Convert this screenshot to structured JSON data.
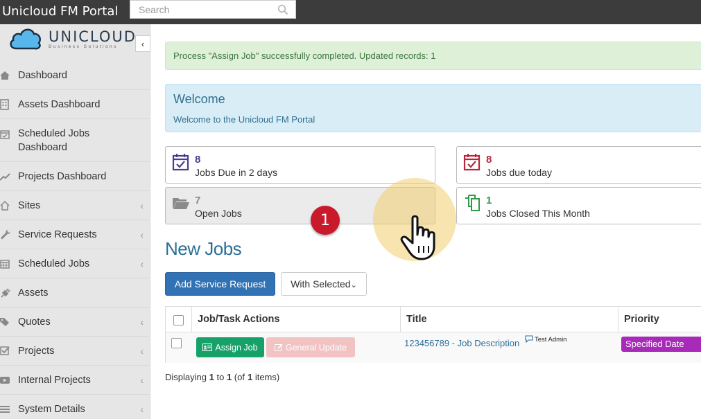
{
  "app": {
    "title": "Unicloud FM Portal"
  },
  "search": {
    "placeholder": "Search"
  },
  "logo": {
    "name": "UNICLOUD",
    "tagline": "Business Solutions"
  },
  "sidebar": {
    "items": [
      {
        "label": "Dashboard",
        "icon": "home-icon",
        "has_children": false
      },
      {
        "label": "Assets Dashboard",
        "icon": "building-icon",
        "has_children": false
      },
      {
        "label": "Scheduled Jobs Dashboard",
        "label_line1": "Scheduled Jobs",
        "label_line2": "Dashboard",
        "icon": "calendar-check-icon",
        "has_children": false
      },
      {
        "label": "Projects Dashboard",
        "icon": "line-chart-icon",
        "has_children": false
      },
      {
        "label": "Sites",
        "icon": "home-outline-icon",
        "has_children": true
      },
      {
        "label": "Service Requests",
        "icon": "wrench-icon",
        "has_children": true
      },
      {
        "label": "Scheduled Jobs",
        "icon": "calendar-icon",
        "has_children": true
      },
      {
        "label": "Assets",
        "icon": "plug-icon",
        "has_children": false
      },
      {
        "label": "Quotes",
        "icon": "tags-icon",
        "has_children": true
      },
      {
        "label": "Projects",
        "icon": "checkbox-icon",
        "has_children": true
      },
      {
        "label": "Internal Projects",
        "icon": "video-icon",
        "has_children": true
      },
      {
        "label": "System Details",
        "icon": "list-icon",
        "has_children": true
      }
    ]
  },
  "alert": {
    "text": "Process \"Assign Job\" successfully completed. Updated records: 1"
  },
  "welcome": {
    "title": "Welcome",
    "text": "Welcome to the Unicloud FM Portal"
  },
  "stats": [
    {
      "value": "8",
      "label": "Jobs Due in 2 days",
      "color": "#4a3d8f",
      "icon": "calendar-check-icon"
    },
    {
      "value": "8",
      "label": "Jobs due today",
      "color": "#b5283c",
      "icon": "calendar-check-icon"
    },
    {
      "value": "7",
      "label": "Open Jobs",
      "color": "#888888",
      "icon": "folder-open-icon"
    },
    {
      "value": "1",
      "label": "Jobs Closed This Month",
      "color": "#2e9a4a",
      "icon": "copy-icon"
    }
  ],
  "section": {
    "title": "New Jobs"
  },
  "toolbar": {
    "add_label": "Add Service Request",
    "with_selected_label": "With Selected"
  },
  "grid": {
    "columns": [
      "Job/Task Actions",
      "Title",
      "Priority"
    ],
    "rows": [
      {
        "assign_label": "Assign Job",
        "general_label": "General Update",
        "title": "123456789 - Job Description",
        "comment_by": "Test Admin",
        "priority": "Specified Date"
      }
    ]
  },
  "pager": {
    "prefix": "Displaying",
    "from": "1",
    "to_word": "to",
    "to": "1",
    "of_open": "(of",
    "total": "1",
    "items_close": "items)"
  },
  "tutorial": {
    "step": "1"
  },
  "colors": {
    "topbar": "#3c3c3c",
    "primary": "#3172b4",
    "success": "#16a168",
    "priority": "#a72ab8"
  }
}
